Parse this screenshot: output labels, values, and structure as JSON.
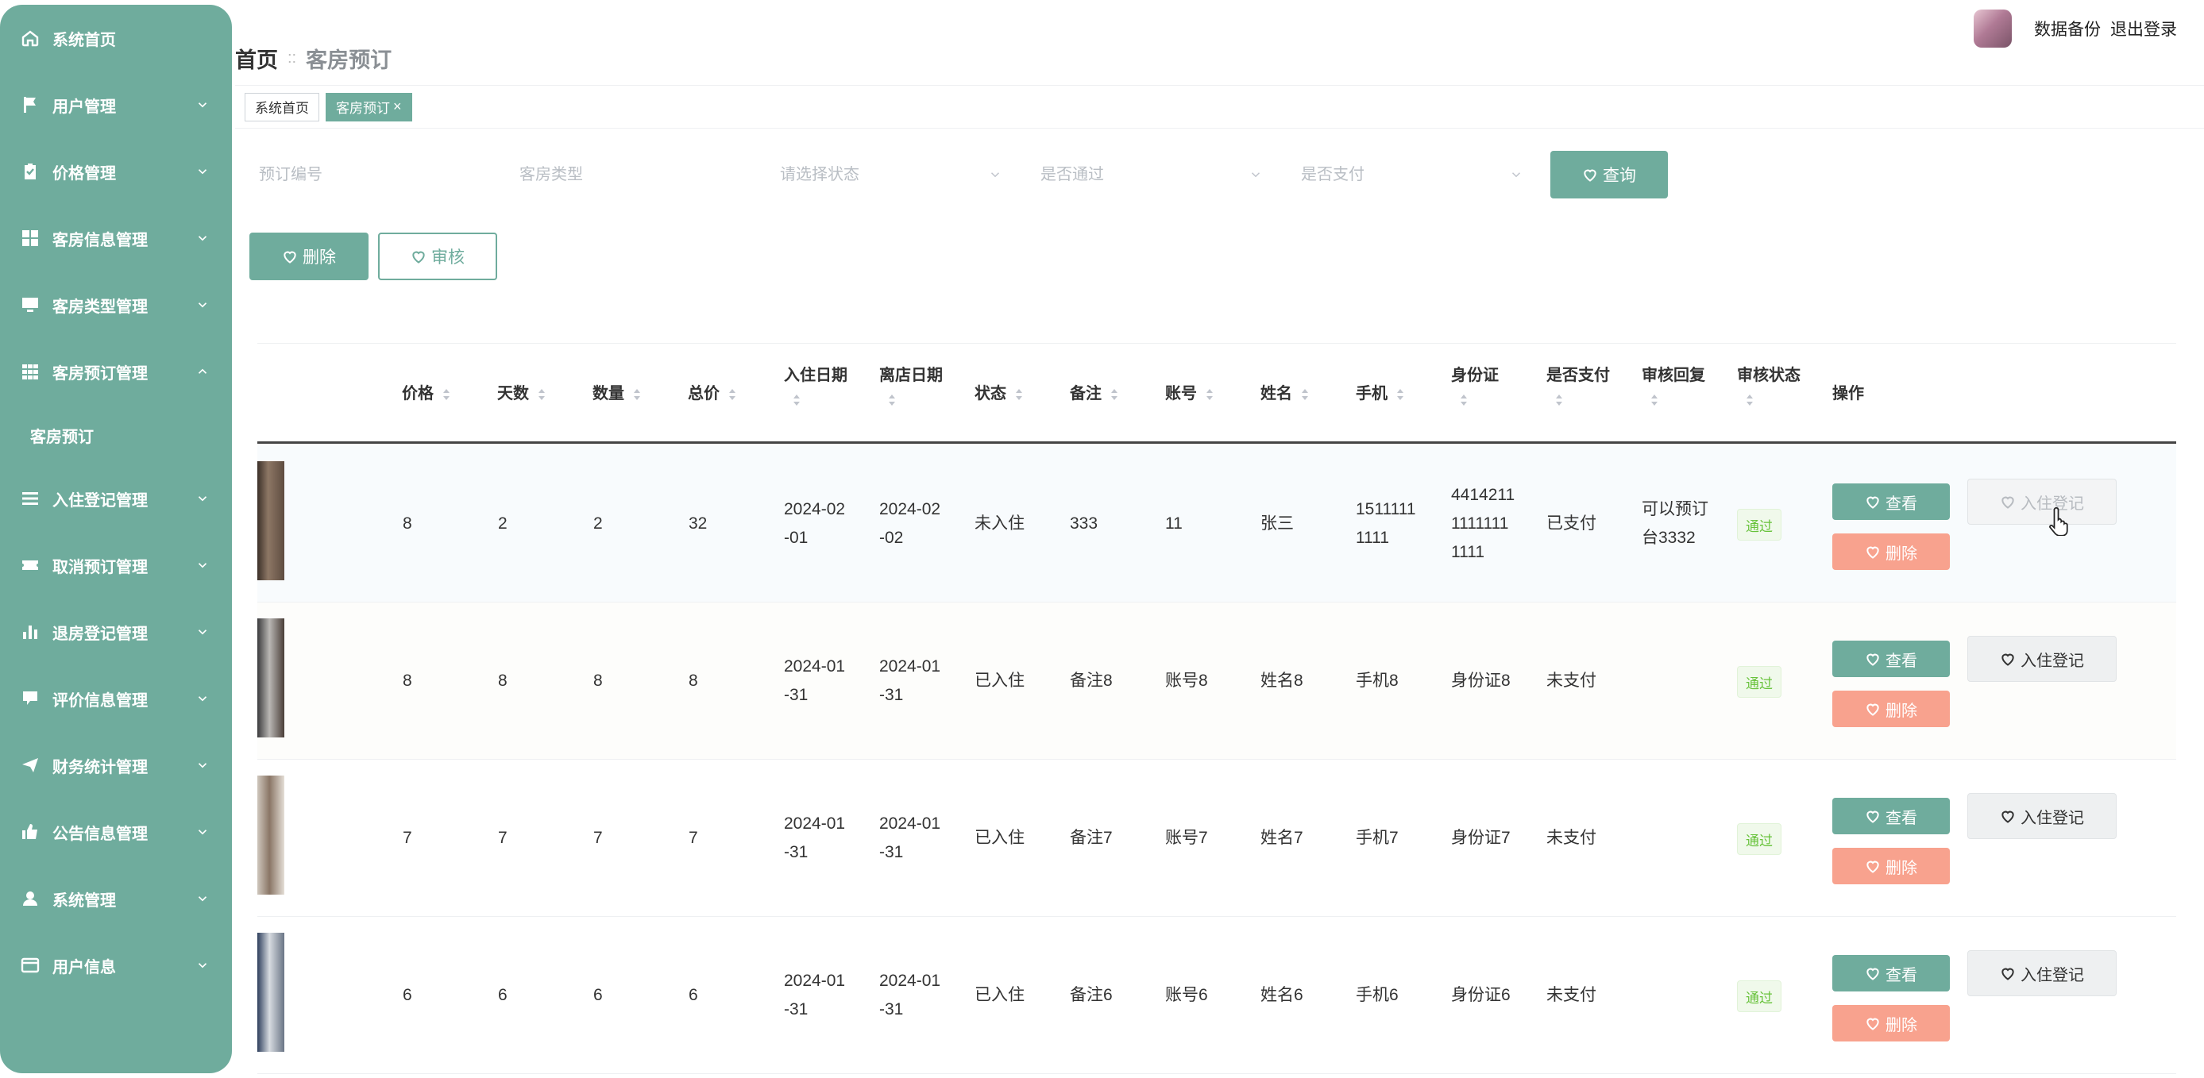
{
  "sidebar": {
    "items": [
      {
        "label": "系统首页",
        "icon": "home-icon"
      },
      {
        "label": "用户管理",
        "icon": "flag-icon"
      },
      {
        "label": "价格管理",
        "icon": "clipboard-icon"
      },
      {
        "label": "客房信息管理",
        "icon": "grid-icon"
      },
      {
        "label": "客房类型管理",
        "icon": "monitor-icon"
      },
      {
        "label": "客房预订管理",
        "icon": "table-icon"
      },
      {
        "label": "客房预订",
        "icon": ""
      },
      {
        "label": "入住登记管理",
        "icon": "list-icon"
      },
      {
        "label": "取消预订管理",
        "icon": "ticket-icon"
      },
      {
        "label": "退房登记管理",
        "icon": "bar-chart-icon"
      },
      {
        "label": "评价信息管理",
        "icon": "comment-icon"
      },
      {
        "label": "财务统计管理",
        "icon": "send-icon"
      },
      {
        "label": "公告信息管理",
        "icon": "thumb-up-icon"
      },
      {
        "label": "系统管理",
        "icon": "user-icon"
      },
      {
        "label": "用户信息",
        "icon": "wallet-icon"
      }
    ]
  },
  "header": {
    "backup_label": "数据备份",
    "logout_label": "退出登录",
    "breadcrumb_home": "首页",
    "breadcrumb_sep": "::",
    "breadcrumb_current": "客房预订"
  },
  "tags": {
    "home": "系统首页",
    "current": "客房预订",
    "close": "×"
  },
  "search": {
    "booking_no_placeholder": "预订编号",
    "room_type_placeholder": "客房类型",
    "status_placeholder": "请选择状态",
    "approved_placeholder": "是否通过",
    "paid_placeholder": "是否支付",
    "query_label": "查询"
  },
  "actions": {
    "delete_label": "删除",
    "review_label": "审核"
  },
  "table": {
    "headers": {
      "price": "价格",
      "days": "天数",
      "qty": "数量",
      "total": "总价",
      "checkin_date": "入住日期",
      "checkout_date": "离店日期",
      "status": "状态",
      "remark": "备注",
      "account": "账号",
      "name": "姓名",
      "phone": "手机",
      "idcard": "身份证",
      "paid": "是否支付",
      "reply": "审核回复",
      "review_status": "审核状态",
      "ops": "操作"
    },
    "rows": [
      {
        "price": "8",
        "days": "2",
        "qty": "2",
        "total": "32",
        "checkin_a": "2024-02",
        "checkin_b": "-01",
        "checkout_a": "2024-02",
        "checkout_b": "-02",
        "status": "未入住",
        "remark": "333",
        "account": "11",
        "name": "张三",
        "phone_a": "1511111",
        "phone_b": "1111",
        "id_a": "4414211",
        "id_b": "1111111",
        "id_c": "1111",
        "paid": "已支付",
        "reply_a": "可以预订",
        "reply_b": "台3332",
        "review": "通过",
        "view": "查看",
        "del": "删除",
        "checkin": "入住登记"
      },
      {
        "price": "8",
        "days": "8",
        "qty": "8",
        "total": "8",
        "checkin_a": "2024-01",
        "checkin_b": "-31",
        "checkout_a": "2024-01",
        "checkout_b": "-31",
        "status": "已入住",
        "remark": "备注8",
        "account": "账号8",
        "name": "姓名8",
        "phone_a": "手机8",
        "phone_b": "",
        "id_a": "身份证8",
        "id_b": "",
        "id_c": "",
        "paid": "未支付",
        "reply_a": "",
        "reply_b": "",
        "review": "通过",
        "view": "查看",
        "del": "删除",
        "checkin": "入住登记"
      },
      {
        "price": "7",
        "days": "7",
        "qty": "7",
        "total": "7",
        "checkin_a": "2024-01",
        "checkin_b": "-31",
        "checkout_a": "2024-01",
        "checkout_b": "-31",
        "status": "已入住",
        "remark": "备注7",
        "account": "账号7",
        "name": "姓名7",
        "phone_a": "手机7",
        "phone_b": "",
        "id_a": "身份证7",
        "id_b": "",
        "id_c": "",
        "paid": "未支付",
        "reply_a": "",
        "reply_b": "",
        "review": "通过",
        "view": "查看",
        "del": "删除",
        "checkin": "入住登记"
      },
      {
        "price": "6",
        "days": "6",
        "qty": "6",
        "total": "6",
        "checkin_a": "2024-01",
        "checkin_b": "-31",
        "checkout_a": "2024-01",
        "checkout_b": "-31",
        "status": "已入住",
        "remark": "备注6",
        "account": "账号6",
        "name": "姓名6",
        "phone_a": "手机6",
        "phone_b": "",
        "id_a": "身份证6",
        "id_b": "",
        "id_c": "",
        "paid": "未支付",
        "reply_a": "",
        "reply_b": "",
        "review": "通过",
        "view": "查看",
        "del": "删除",
        "checkin": "入住登记"
      }
    ]
  },
  "colors": {
    "accent": "#6fac9d",
    "danger": "#f8a28e",
    "success": "#67c23a"
  }
}
